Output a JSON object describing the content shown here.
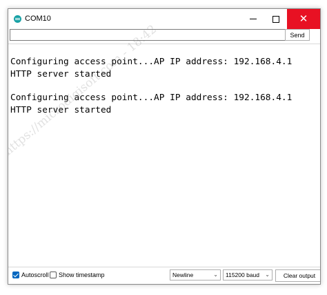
{
  "window": {
    "title": "COM10",
    "close_color": "#e81123"
  },
  "send_bar": {
    "input_value": "",
    "send_label": "Send"
  },
  "output": {
    "lines": [
      "Configuring access point...AP IP address: 192.168.4.1",
      "HTTP server started",
      "Configuring access point...AP IP address: 192.168.4.1",
      "HTTP server started"
    ]
  },
  "watermark": "https://microdigisoft.com - 18:42",
  "statusbar": {
    "autoscroll_label": "Autoscroll",
    "autoscroll_checked": true,
    "timestamp_label": "Show timestamp",
    "timestamp_checked": false,
    "line_ending": "Newline",
    "baud_rate": "115200 baud",
    "clear_label": "Clear output"
  },
  "colors": {
    "accent": "#0067c0",
    "icon": "#17a1a5"
  }
}
